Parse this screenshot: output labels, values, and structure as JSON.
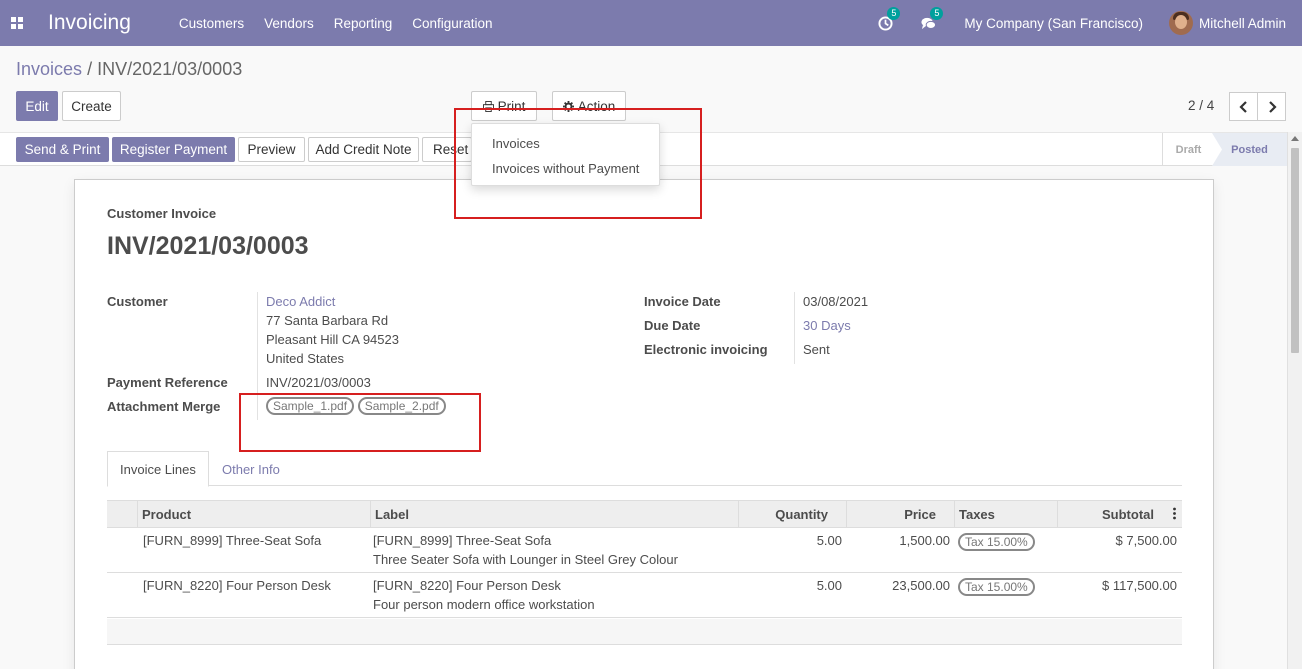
{
  "navbar": {
    "app_title": "Invoicing",
    "menu": [
      "Customers",
      "Vendors",
      "Reporting",
      "Configuration"
    ],
    "activity_badge": "5",
    "messages_badge": "5",
    "company": "My Company (San Francisco)",
    "user": "Mitchell Admin",
    "color": "#7c7bad"
  },
  "breadcrumb": {
    "parent": "Invoices",
    "separator": "/",
    "current": "INV/2021/03/0003"
  },
  "buttons": {
    "edit": "Edit",
    "create": "Create",
    "print": "Print",
    "action": "Action",
    "send_print": "Send & Print",
    "register_payment": "Register Payment",
    "preview": "Preview",
    "add_credit_note": "Add Credit Note",
    "reset": "Reset"
  },
  "pager": "2 / 4",
  "status": {
    "draft": "Draft",
    "posted": "Posted",
    "active": "Posted"
  },
  "print_menu": [
    "Invoices",
    "Invoices without Payment"
  ],
  "invoice": {
    "type_label": "Customer Invoice",
    "name": "INV/2021/03/0003",
    "customer_label": "Customer",
    "customer_name": "Deco Addict",
    "address_line1": "77 Santa Barbara Rd",
    "address_line2": "Pleasant Hill CA 94523",
    "address_line3": "United States",
    "payment_ref_label": "Payment Reference",
    "payment_ref": "INV/2021/03/0003",
    "attachment_label": "Attachment Merge",
    "attachments": [
      "Sample_1.pdf",
      "Sample_2.pdf"
    ],
    "invoice_date_label": "Invoice Date",
    "invoice_date": "03/08/2021",
    "due_date_label": "Due Date",
    "due_date": "30 Days",
    "einvoicing_label": "Electronic invoicing",
    "einvoicing": "Sent"
  },
  "tabs": [
    "Invoice Lines",
    "Other Info"
  ],
  "lines": {
    "headers": [
      "Product",
      "Label",
      "Quantity",
      "Price",
      "Taxes",
      "Subtotal"
    ],
    "rows": [
      {
        "product": "[FURN_8999] Three-Seat Sofa",
        "label1": "[FURN_8999] Three-Seat Sofa",
        "label2": "Three Seater Sofa with Lounger in Steel Grey Colour",
        "quantity": "5.00",
        "price": "1,500.00",
        "tax": "Tax 15.00%",
        "subtotal": "$ 7,500.00"
      },
      {
        "product": "[FURN_8220] Four Person Desk",
        "label1": "[FURN_8220] Four Person Desk",
        "label2": "Four person modern office workstation",
        "quantity": "5.00",
        "price": "23,500.00",
        "tax": "Tax 15.00%",
        "subtotal": "$ 117,500.00"
      }
    ]
  }
}
